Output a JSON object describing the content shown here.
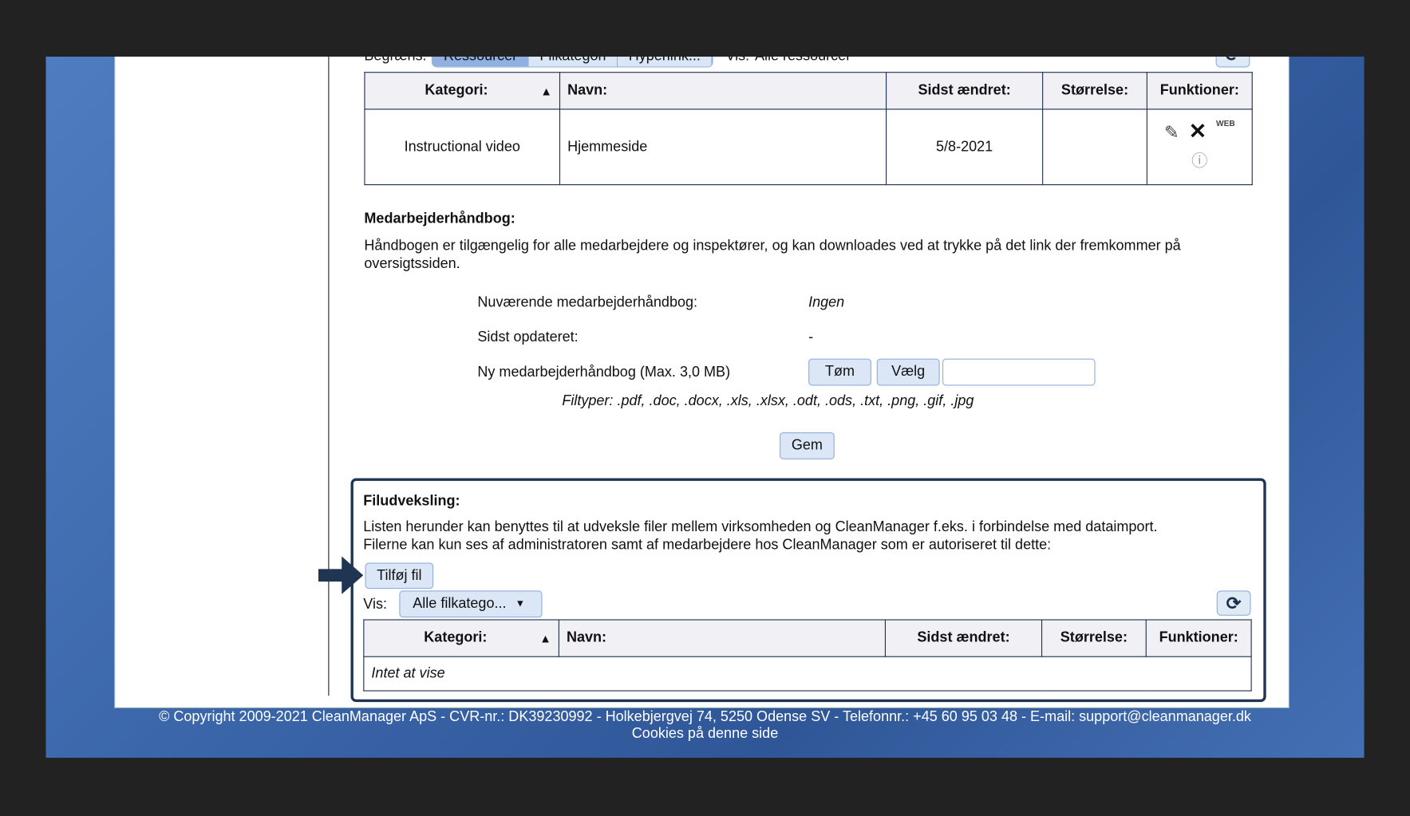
{
  "top_filter": {
    "label": "Begræns:",
    "tabs": [
      "Ressourcer",
      "Filkategori",
      "Hyperlink..."
    ],
    "vis_label": "Vis:",
    "vis_value": "Alle ressourcer"
  },
  "columns": [
    "Kategori:",
    "Navn:",
    "Sidst ændret:",
    "Størrelse:",
    "Funktioner:"
  ],
  "resources": [
    {
      "kategori": "Instructional video",
      "navn": "Hjemmeside",
      "sidst_aendret": "5/8-2021",
      "stoerrelse": "",
      "web_label": "WEB"
    }
  ],
  "handbook": {
    "title": "Medarbejderhåndbog:",
    "description": "Håndbogen er tilgængelig for alle medarbejdere og inspektører, og kan downloades ved at trykke på det link der fremkommer på oversigtssiden.",
    "current_label": "Nuværende medarbejderhåndbog:",
    "current_value": "Ingen",
    "updated_label": "Sidst opdateret:",
    "updated_value": "-",
    "new_label": "Ny medarbejderhåndbog (Max. 3,0 MB)",
    "clear_button": "Tøm",
    "choose_button": "Vælg",
    "file_value": "",
    "filetypes": "Filtyper: .pdf, .doc, .docx, .xls, .xlsx, .odt, .ods, .txt, .png, .gif, .jpg",
    "save_button": "Gem"
  },
  "exchange": {
    "title": "Filudveksling:",
    "line1": "Listen herunder kan benyttes til at udveksle filer mellem virksomheden og CleanManager f.eks. i forbindelse med dataimport.",
    "line2": "Filerne kan kun ses af administratoren samt af medarbejdere hos CleanManager som er autoriseret til dette:",
    "add_button": "Tilføj fil",
    "vis_label": "Vis:",
    "vis_value": "Alle filkatego...",
    "empty": "Intet at vise"
  },
  "footer": {
    "copyright": "© Copyright 2009-2021 CleanManager ApS - CVR-nr.: DK39230992 - Holkebjergvej 74, 5250 Odense SV - Telefonnr.: +45 60 95 03 48 - E-mail: support@cleanmanager.dk",
    "cookies": "Cookies på denne side"
  },
  "colors": {
    "accent": "#1f3552",
    "button_bg": "#dbe7f6",
    "background_blue": "#3b66aa"
  }
}
